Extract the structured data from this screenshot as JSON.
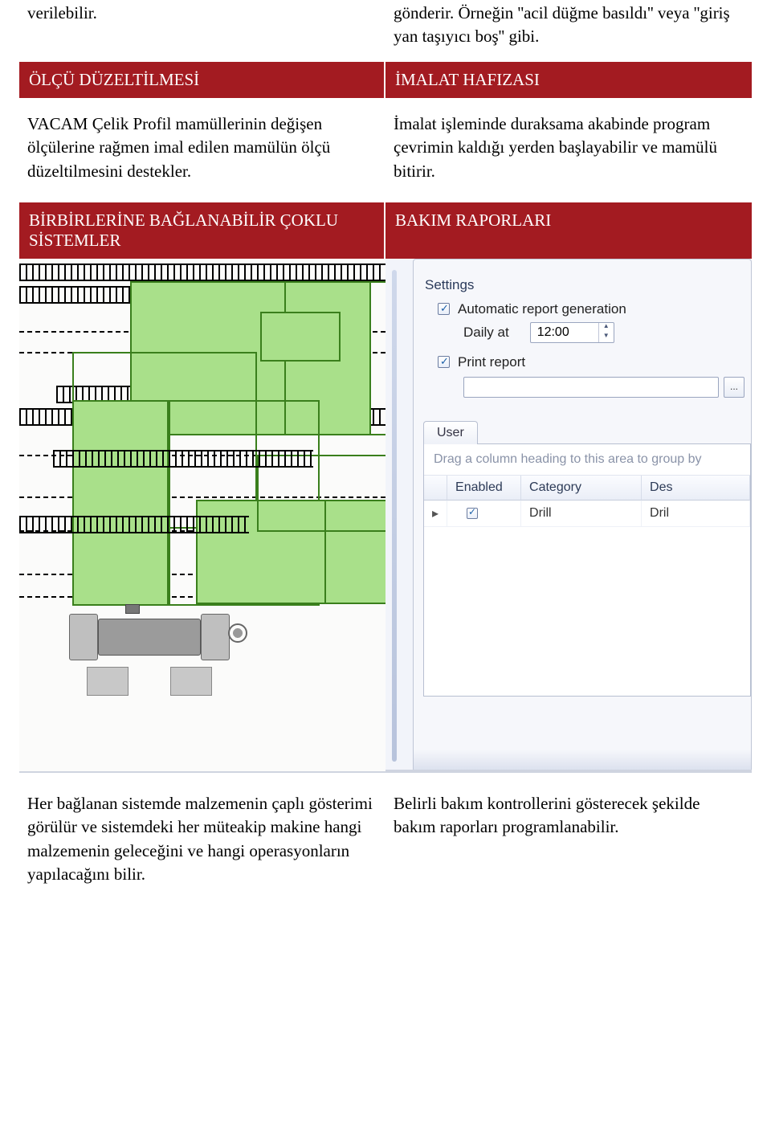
{
  "intro": {
    "left": "verilebilir.",
    "right": "gönderir. Örneğin ''acil düğme basıldı'' veya ''giriş yan taşıyıcı boş'' gibi."
  },
  "section1": {
    "left": {
      "title": "ÖLÇÜ DÜZELTİLMESİ",
      "body": "VACAM Çelik Profil mamüllerinin değişen ölçülerine rağmen imal edilen mamülün ölçü düzeltilmesini destekler."
    },
    "right": {
      "title": "İMALAT HAFIZASI",
      "body": "İmalat işleminde duraksama akabinde program çevrimin kaldığı yerden başlayabilir ve mamülü bitirir."
    }
  },
  "section2": {
    "left": {
      "title": "BİRBİRLERİNE BAĞLANABİLİR ÇOKLU SİSTEMLER"
    },
    "right": {
      "title": "BAKIM RAPORLARI"
    }
  },
  "settings_panel": {
    "group_label": "Settings",
    "auto_report_label": "Automatic report generation",
    "auto_report_checked": true,
    "daily_at_label": "Daily at",
    "daily_at_value": "12:00",
    "print_label": "Print report",
    "print_checked": true,
    "path_value": "",
    "browse_label": "...",
    "tabs": {
      "user": "User"
    },
    "grid": {
      "group_hint": "Drag a column heading to this area to group by",
      "columns": {
        "enabled": "Enabled",
        "category": "Category",
        "des": "Des"
      },
      "rows": [
        {
          "enabled": true,
          "category": "Drill",
          "des": "Dril"
        }
      ]
    }
  },
  "bottom": {
    "left": "Her bağlanan sistemde malzemenin çaplı gösterimi görülür ve sistemdeki her müteakip makine hangi malzemenin geleceğini ve hangi operasyonların yapılacağını bilir.",
    "right": "Belirli bakım kontrollerini gösterecek şekilde bakım raporları programlanabilir."
  }
}
